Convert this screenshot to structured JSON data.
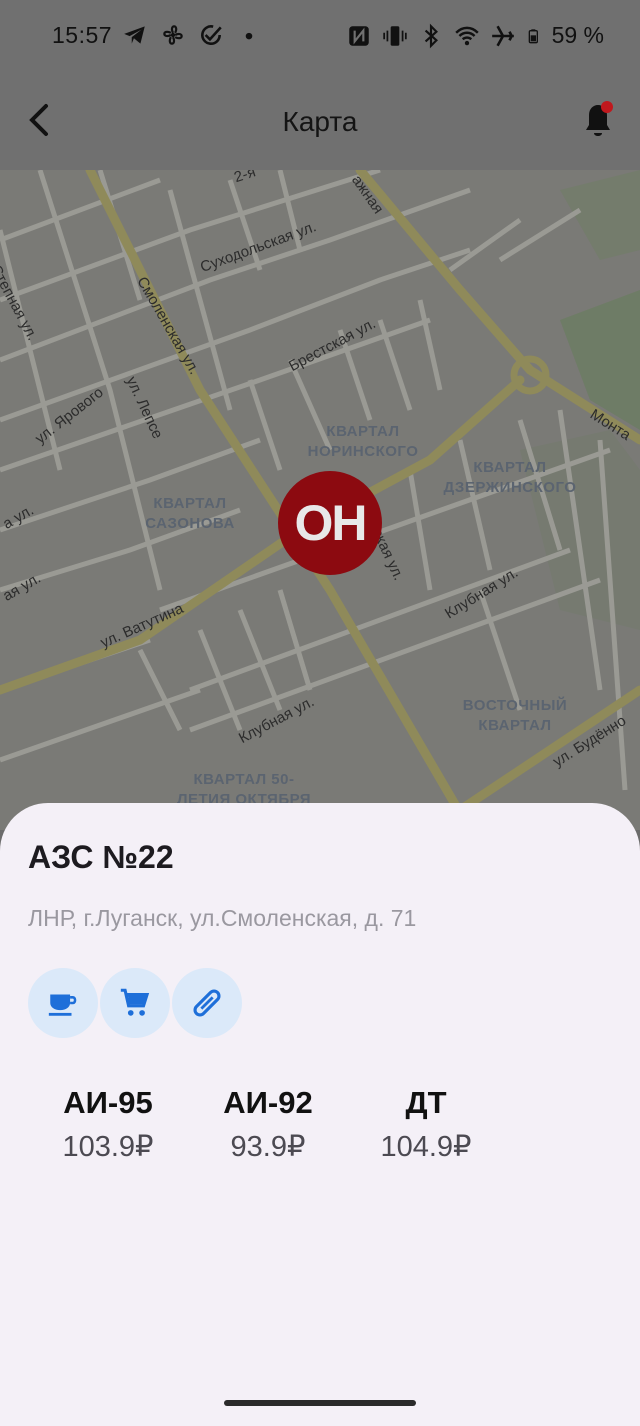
{
  "status_bar": {
    "time": "15:57",
    "battery": "59 %",
    "left_icons": [
      "telegram-icon",
      "fan-icon",
      "check-circle-icon",
      "dot-icon"
    ],
    "right_icons": [
      "nfc-icon",
      "vibrate-icon",
      "bluetooth-icon",
      "wifi-icon",
      "airplane-icon",
      "battery-icon"
    ]
  },
  "app_bar": {
    "title": "Карта",
    "back_icon": "arrow-back-icon",
    "bell_icon": "bell-icon",
    "bell_badge_color": "#c0181d"
  },
  "map": {
    "street_labels": [
      "2-я",
      "Суходольская ул.",
      "ажная",
      "Степная ул.",
      "Смоленская ул.",
      "Брестская ул.",
      "ул. Ярового",
      "ул. Лепсе",
      "Монта",
      "ул. Ватутина",
      "ская ул.",
      "Клубная ул.",
      "Клубная ул.",
      "ул. Будённо",
      "а ул.",
      "ая ул."
    ],
    "districts": [
      "КВАРТАЛ\nНОРИНСКОГО",
      "КВАРТАЛ\nДЗЕРЖИНСКОГО",
      "КВАРТАЛ\nСАЗОНОВА",
      "ВОСТОЧНЫЙ\nКВАРТАЛ",
      "КВАРТАЛ 50-\nЛЕТИЯ ОКТЯБРЯ"
    ],
    "marker_text": "ОН",
    "marker_color": "#8c0a10"
  },
  "station": {
    "name": "АЗС №22",
    "address": "ЛНР, г.Луганск, ул.Смоленская, д. 71",
    "services": [
      "coffee-cup-icon",
      "shopping-cart-icon",
      "hotdog-icon"
    ],
    "service_bg": "#dbe9f9",
    "service_icon_color": "#1e6fd9",
    "fuels": [
      {
        "name": "АИ-95",
        "price": "103.9₽"
      },
      {
        "name": "АИ-92",
        "price": "93.9₽"
      },
      {
        "name": "ДТ",
        "price": "104.9₽"
      }
    ]
  }
}
